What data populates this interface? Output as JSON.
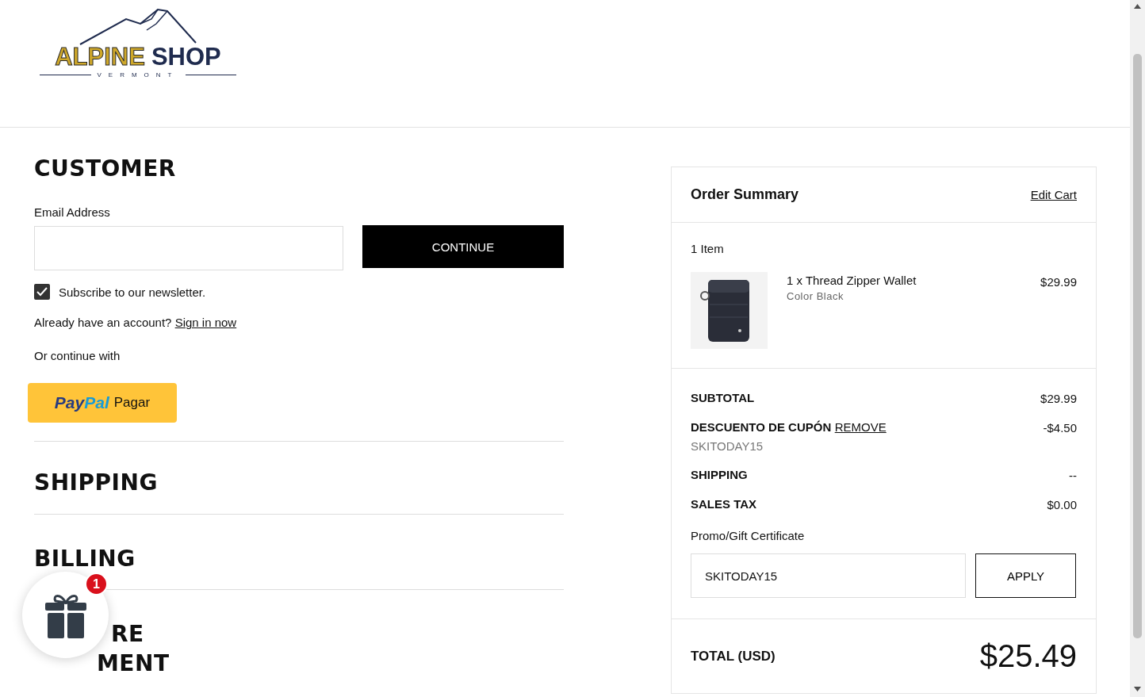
{
  "logo": {
    "word_1": "ALPINE",
    "word_2": "SHOP",
    "tagline": "VERMONT"
  },
  "customer": {
    "heading": "CUSTOMER",
    "email_label": "Email Address",
    "continue_button": "CONTINUE",
    "newsletter": {
      "label": "Subscribe to our newsletter.",
      "checked": true
    },
    "account_prompt": "Already have an account?",
    "sign_in_link": "Sign in now",
    "alt_label": "Or continue with",
    "paypal": {
      "brand_1": "Pay",
      "brand_2": "Pal",
      "label": "Pagar"
    }
  },
  "sections": [
    {
      "heading": "SHIPPING"
    },
    {
      "heading": "BILLING"
    },
    {
      "heading_lines": [
        "RE",
        "MENT"
      ]
    }
  ],
  "gift_widget": {
    "badge": "1"
  },
  "order_summary": {
    "title": "Order Summary",
    "edit_link": "Edit Cart",
    "item_count": "1 Item",
    "items": [
      {
        "name": "1 x Thread Zipper Wallet",
        "option": "Color Black",
        "price": "$29.99"
      }
    ],
    "totals": [
      {
        "label": "SUBTOTAL",
        "value": "$29.99"
      },
      {
        "label": "DESCUENTO DE CUPÓN",
        "link": "REMOVE",
        "value": "-$4.50",
        "code": "SKITODAY15"
      },
      {
        "label": "SHIPPING",
        "value": "--"
      },
      {
        "label": "SALES TAX",
        "value": "$0.00"
      }
    ],
    "promo": {
      "label": "Promo/Gift Certificate",
      "value": "SKITODAY15",
      "button": "APPLY"
    },
    "total": {
      "label": "TOTAL (USD)",
      "value": "$25.49"
    }
  }
}
